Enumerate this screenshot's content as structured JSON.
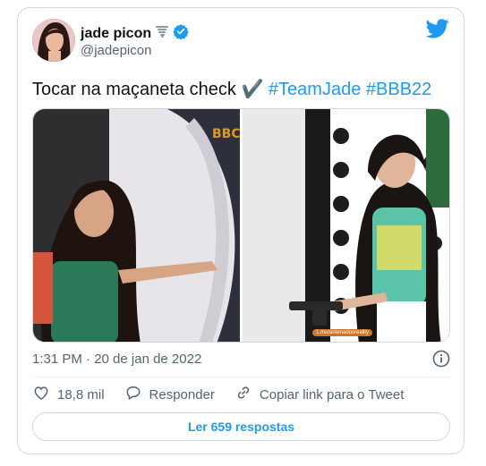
{
  "tweet": {
    "author_name": "jade picon",
    "author_handle": "@jadepicon",
    "text_plain": "Tocar na maçaneta check ✔️ ",
    "hashtags": [
      "#TeamJade",
      "#BBB22"
    ],
    "timestamp": "1:31 PM · 20 de jan de 2022",
    "watermark": "1.mu/antenadosreality"
  },
  "actions": {
    "likes": "18,8 mil",
    "reply_label": "Responder",
    "copy_label": "Copiar link para o Tweet"
  },
  "read_replies_label": "Ler 659 respostas",
  "colors": {
    "accent": "#1d9bf0",
    "text": "#0f1419",
    "muted": "#536471",
    "border": "#cfd9de"
  },
  "icons": [
    "tornado-emoji-icon",
    "verified-badge-icon",
    "twitter-bird-icon",
    "info-icon",
    "heart-icon",
    "reply-icon",
    "link-icon"
  ]
}
